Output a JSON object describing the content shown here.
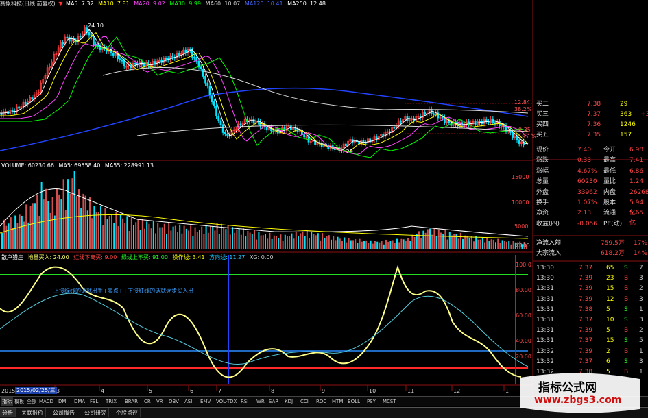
{
  "colors": {
    "up": "#ff3b3b",
    "down": "#00e5ff",
    "ma5": "#ffffff",
    "ma10": "#ffff00",
    "ma20": "#ff44ff",
    "ma30": "#00ff00",
    "ma60": "#cccccc",
    "ma120": "#2244ff",
    "accent": "#ff3333"
  },
  "header": {
    "title": "赛象科技(日线 前复权)",
    "ma5": "MA5: 7.32",
    "ma10": "MA10: 7.81",
    "ma20": "MA20: 9.02",
    "ma30": "MA30: 9.99",
    "ma60": "MA60: 10.07",
    "ma120": "MA120: 10.41",
    "ma250": "MA250: 12.48",
    "high_label": "24.10",
    "low_label": "6.29"
  },
  "price_axis": [
    "12.84",
    "38.2%",
    "9.35",
    "19.1%"
  ],
  "volume": {
    "header_volume": "VOLUME: 60230.66",
    "header_ma5": "MA5: 69558.40",
    "header_ma55": "MA55: 228991.13",
    "axis": [
      "15000",
      "10000",
      "5000"
    ],
    "unit": "X100"
  },
  "indicator": {
    "name": "散户猎庄",
    "l1": "地量买入: 24.00",
    "l2": "红线下离买: 9.00",
    "l3": "绿线上不买: 91.00",
    "l4": "操作线: 3.41",
    "l5": "方向线: 11.27",
    "l6": "XG: 0.00",
    "note": "上接绿线的话就出手+卖点++下接红线的话就逐步买入出",
    "axis": [
      "100.0",
      "80.00",
      "60.00",
      "40.00",
      "20.00"
    ]
  },
  "x_axis": {
    "months": [
      "3",
      "4",
      "5",
      "6",
      "7",
      "8",
      "9",
      "10",
      "11",
      "12",
      "1"
    ],
    "start": "2015",
    "date": "2015/02/25/三"
  },
  "quotes": {
    "book": [
      {
        "label": "买二",
        "price": "7.38",
        "vol": "29",
        "chg": ""
      },
      {
        "label": "买三",
        "price": "7.37",
        "vol": "363",
        "chg": "+3"
      },
      {
        "label": "买四",
        "price": "7.36",
        "vol": "1246",
        "chg": ""
      },
      {
        "label": "买五",
        "price": "7.35",
        "vol": "157",
        "chg": ""
      }
    ],
    "stats": [
      {
        "l1": "现价",
        "v1": "7.40",
        "l2": "今开",
        "v2": "6.98"
      },
      {
        "l1": "涨跌",
        "v1": "0.33",
        "l2": "最高",
        "v2": "7.41"
      },
      {
        "l1": "涨幅",
        "v1": "4.67%",
        "l2": "最低",
        "v2": "6.86"
      },
      {
        "l1": "总量",
        "v1": "60230",
        "l2": "量比",
        "v2": "1.24"
      },
      {
        "l1": "外盘",
        "v1": "33962",
        "l2": "内盘",
        "v2": "26268"
      },
      {
        "l1": "换手",
        "v1": "1.07%",
        "l2": "股本",
        "v2": "5.94亿"
      },
      {
        "l1": "净资",
        "v1": "2.13",
        "l2": "流通",
        "v2": "5.65亿"
      },
      {
        "l1": "收益(四)",
        "v1": "-0.056",
        "l2": "PE(动)",
        "v2": ""
      }
    ],
    "flows": [
      {
        "label": "净流入额",
        "value": "759.5万",
        "pct": "17%"
      },
      {
        "label": "大宗流入",
        "value": "618.2万",
        "pct": "14%"
      }
    ],
    "ticks": [
      {
        "t": "13:30",
        "p": "7.37",
        "v": "65",
        "s": "S",
        "n": "7"
      },
      {
        "t": "13:30",
        "p": "7.39",
        "v": "23",
        "s": "B",
        "n": "3"
      },
      {
        "t": "13:31",
        "p": "7.39",
        "v": "15",
        "s": "B",
        "n": "2"
      },
      {
        "t": "13:31",
        "p": "7.39",
        "v": "12",
        "s": "B",
        "n": "3"
      },
      {
        "t": "13:31",
        "p": "7.38",
        "v": "5",
        "s": "S",
        "n": "1"
      },
      {
        "t": "13:31",
        "p": "7.37",
        "v": "10",
        "s": "S",
        "n": "3"
      },
      {
        "t": "13:31",
        "p": "7.39",
        "v": "5",
        "s": "B",
        "n": "2"
      },
      {
        "t": "13:31",
        "p": "7.37",
        "v": "15",
        "s": "S",
        "n": "5"
      },
      {
        "t": "13:32",
        "p": "7.39",
        "v": "2",
        "s": "B",
        "n": "1"
      },
      {
        "t": "13:32",
        "p": "7.37",
        "v": "6",
        "s": "S",
        "n": "3"
      },
      {
        "t": "13:32",
        "p": "7.38",
        "v": "5",
        "s": "B",
        "n": "1"
      }
    ]
  },
  "tabs": [
    "指标",
    "模板",
    "全部",
    "MACD",
    "DMI",
    "DMA",
    "FSL",
    "TRIX",
    "BRAR",
    "CR",
    "VR",
    "OBV",
    "ASI",
    "EMV",
    "VOL-TDX",
    "RSI",
    "WR",
    "SAR",
    "KDJ",
    "CCI",
    "ROC",
    "MTM",
    "BOLL",
    "PSY",
    "MCST"
  ],
  "bottom_tabs": [
    "分析",
    "关联报价",
    "公司报告",
    "公司研究",
    "个股点评"
  ],
  "watermark": {
    "title": "指标公式网",
    "url": "www.zbgs3.com"
  }
}
